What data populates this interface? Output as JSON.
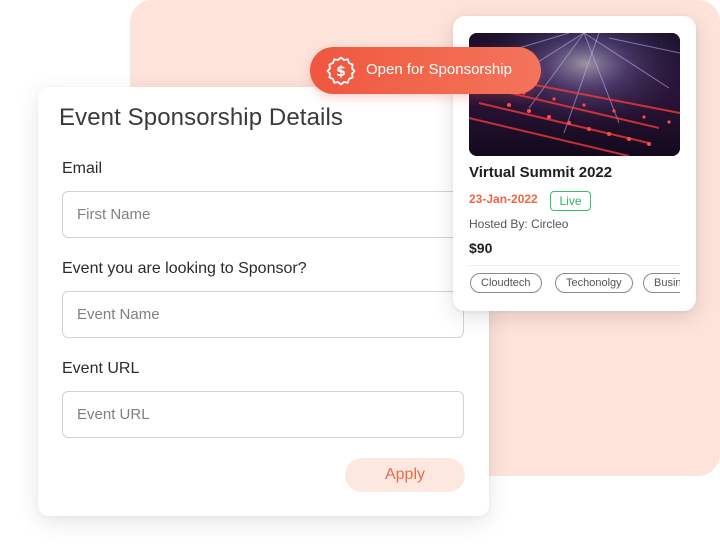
{
  "form": {
    "title": "Event Sponsorship Details",
    "fields": [
      {
        "label": "Email",
        "placeholder": "First Name",
        "value": ""
      },
      {
        "label": "Event you are looking to Sponsor?",
        "placeholder": "Event Name",
        "value": ""
      },
      {
        "label": "Event URL",
        "placeholder": "Event URL",
        "value": ""
      }
    ],
    "apply_label": "Apply"
  },
  "sponsor_badge": {
    "label": "Open for Sponsorship",
    "icon": "dollar-badge-icon"
  },
  "event": {
    "image": "concert-laser-lights-image",
    "title": "Virtual Summit 2022",
    "date": "23-Jan-2022",
    "status": "Live",
    "hosted_by": "Hosted By: Circleo",
    "price": "$90",
    "tags": [
      "Cloudtech",
      "Techonolgy",
      "Business"
    ]
  },
  "colors": {
    "accent": "#ef6547",
    "backdrop": "#fde3da",
    "live": "#2fb564"
  }
}
